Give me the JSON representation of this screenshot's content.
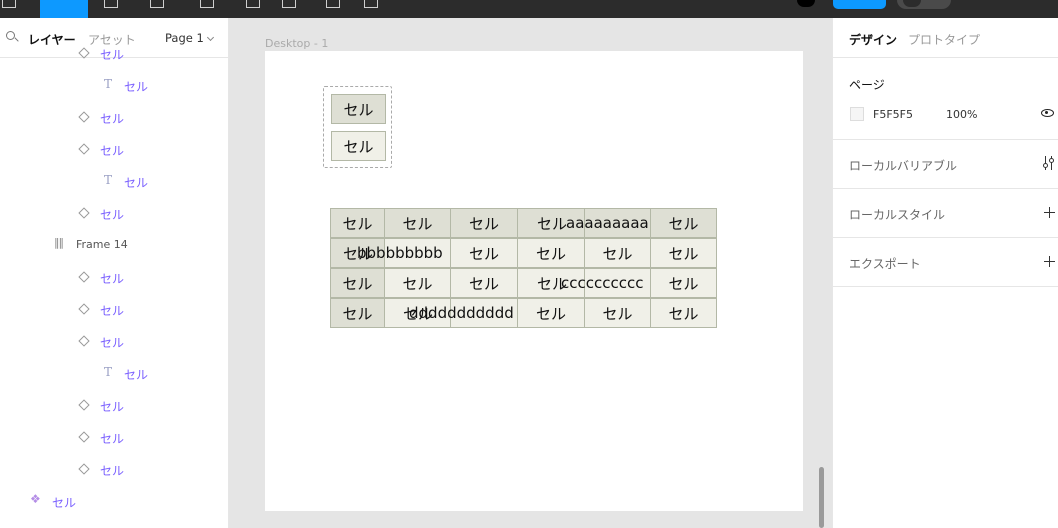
{
  "left_panel": {
    "tabs": {
      "layers": "レイヤー",
      "assets": "アセット"
    },
    "page_selector": "Page 1",
    "layers": [
      {
        "type": "diamond",
        "indent": 1,
        "label": "セル"
      },
      {
        "type": "text",
        "indent": 2,
        "label": "セル"
      },
      {
        "type": "diamond",
        "indent": 1,
        "label": "セル"
      },
      {
        "type": "diamond",
        "indent": 1,
        "label": "セル"
      },
      {
        "type": "text",
        "indent": 2,
        "label": "セル"
      },
      {
        "type": "diamond",
        "indent": 1,
        "label": "セル"
      },
      {
        "type": "frame",
        "indent": 0,
        "label": "Frame 14"
      },
      {
        "type": "diamond",
        "indent": 1,
        "label": "セル"
      },
      {
        "type": "diamond",
        "indent": 1,
        "label": "セル"
      },
      {
        "type": "diamond",
        "indent": 1,
        "label": "セル"
      },
      {
        "type": "text",
        "indent": 2,
        "label": "セル"
      },
      {
        "type": "diamond",
        "indent": 1,
        "label": "セル"
      },
      {
        "type": "diamond",
        "indent": 1,
        "label": "セル"
      },
      {
        "type": "diamond",
        "indent": 1,
        "label": "セル"
      },
      {
        "type": "component",
        "indent": -1,
        "label": "セル"
      }
    ]
  },
  "canvas": {
    "frame_title": "Desktop - 1",
    "stack_cells": [
      {
        "label": "セル",
        "tone": "dark"
      },
      {
        "label": "セル",
        "tone": "light"
      }
    ],
    "table": [
      [
        {
          "label": "セル",
          "tone": "dark"
        },
        {
          "label": "セル",
          "tone": "dark"
        },
        {
          "label": "セル",
          "tone": "dark"
        },
        {
          "label": "セル",
          "tone": "dark",
          "overflow": "aaaaaaaaa"
        },
        {
          "label": "",
          "tone": "dark"
        },
        {
          "label": "セル",
          "tone": "dark"
        }
      ],
      [
        {
          "label": "セル",
          "tone": "dark",
          "overflow": "bbbbbbbbb"
        },
        {
          "label": "",
          "tone": "light"
        },
        {
          "label": "セル",
          "tone": "light"
        },
        {
          "label": "セル",
          "tone": "light"
        },
        {
          "label": "セル",
          "tone": "light"
        },
        {
          "label": "セル",
          "tone": "light"
        }
      ],
      [
        {
          "label": "セル",
          "tone": "dark"
        },
        {
          "label": "セル",
          "tone": "light"
        },
        {
          "label": "セル",
          "tone": "light"
        },
        {
          "label": "セル",
          "tone": "light",
          "overflow": "cccccccccc"
        },
        {
          "label": "",
          "tone": "light"
        },
        {
          "label": "セル",
          "tone": "light"
        }
      ],
      [
        {
          "label": "セル",
          "tone": "dark"
        },
        {
          "label": "セル",
          "tone": "light",
          "overflow": "ddddddddddd"
        },
        {
          "label": "",
          "tone": "light"
        },
        {
          "label": "セル",
          "tone": "light"
        },
        {
          "label": "セル",
          "tone": "light"
        },
        {
          "label": "セル",
          "tone": "light"
        }
      ]
    ]
  },
  "right_panel": {
    "tabs": {
      "design": "デザイン",
      "prototype": "プロトタイプ"
    },
    "page": {
      "title": "ページ",
      "color_hex": "F5F5F5",
      "opacity": "100%"
    },
    "local_variables": "ローカルバリアブル",
    "local_styles": "ローカルスタイル",
    "export": "エクスポート"
  },
  "colors": {
    "accent": "#0d99ff",
    "cell_dark": "#dedfd4",
    "cell_light": "#f0f0e8",
    "cell_border": "#b3b8a6",
    "layer_text": "#7b61ff"
  }
}
